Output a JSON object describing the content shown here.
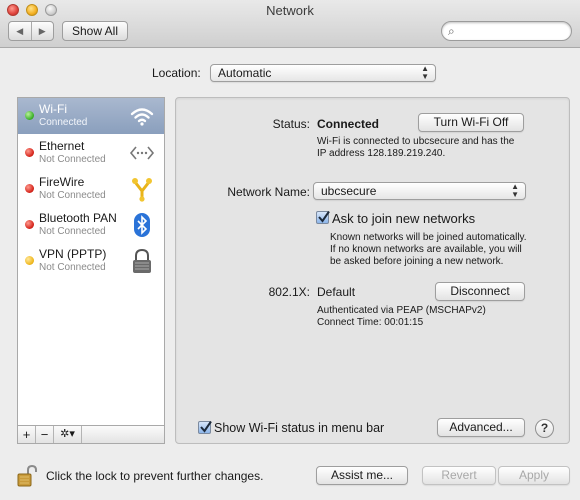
{
  "window": {
    "title": "Network"
  },
  "toolbar": {
    "back": "◀",
    "forward": "▶",
    "show_all": "Show All",
    "search_placeholder": ""
  },
  "location": {
    "label": "Location:",
    "value": "Automatic"
  },
  "services": [
    {
      "name": "Wi-Fi",
      "status": "Connected",
      "dot": "green",
      "icon": "wifi-icon"
    },
    {
      "name": "Ethernet",
      "status": "Not Connected",
      "dot": "red",
      "icon": "ethernet-icon"
    },
    {
      "name": "FireWire",
      "status": "Not Connected",
      "dot": "red",
      "icon": "firewire-icon"
    },
    {
      "name": "Bluetooth PAN",
      "status": "Not Connected",
      "dot": "red",
      "icon": "bluetooth-icon"
    },
    {
      "name": "VPN (PPTP)",
      "status": "Not Connected",
      "dot": "yellow",
      "icon": "vpn-lock-icon"
    }
  ],
  "sidebar_tools": {
    "add": "+",
    "remove": "−",
    "actions": "✲▾"
  },
  "detail": {
    "status_label": "Status:",
    "status_value": "Connected",
    "turn_off": "Turn Wi-Fi Off",
    "status_desc_1": "Wi-Fi is connected to ubcsecure and has the",
    "status_desc_2": "IP address 128.189.219.240.",
    "network_name_label": "Network Name:",
    "network_name_value": "ubcsecure",
    "ask_join_label": "Ask to join new networks",
    "ask_join_checked": true,
    "ask_desc_1": "Known networks will be joined automatically.",
    "ask_desc_2": "If no known networks are available, you will",
    "ask_desc_3": "be asked before joining a new network.",
    "x8021_label": "802.1X:",
    "x8021_value": "Default",
    "disconnect": "Disconnect",
    "auth_1": "Authenticated via PEAP (MSCHAPv2)",
    "auth_2": "Connect Time: 00:01:15",
    "show_status_label": "Show Wi-Fi status in menu bar",
    "show_status_checked": true,
    "advanced": "Advanced...",
    "help": "?"
  },
  "footer": {
    "lock_text": "Click the lock to prevent further changes.",
    "assist": "Assist me...",
    "revert": "Revert",
    "apply": "Apply"
  },
  "colors": {
    "selection": "#9aaac4",
    "connected": "#3cb12b",
    "disconnected": "#d6261c",
    "pending": "#f0b81e",
    "checkbox": "#8db6ea"
  }
}
